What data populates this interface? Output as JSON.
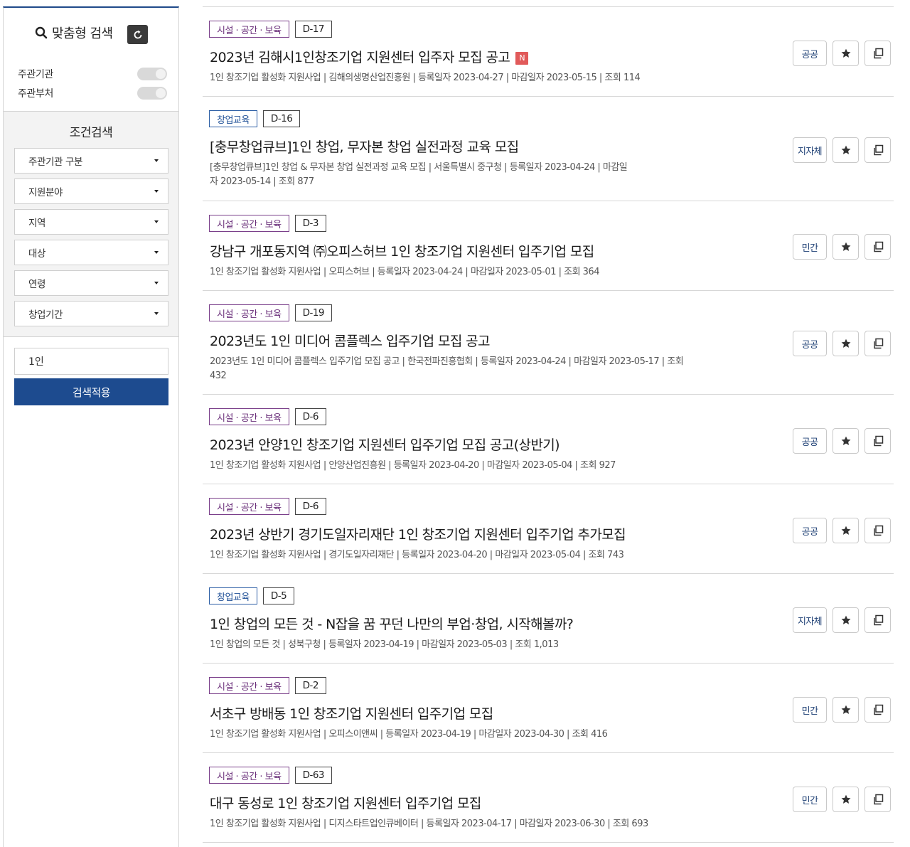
{
  "sidebar": {
    "title": "맞춤형 검색",
    "toggles": [
      {
        "label": "주관기관"
      },
      {
        "label": "주관부처"
      }
    ],
    "condition_title": "조건검색",
    "selects": [
      "주관기관 구분",
      "지원분야",
      "지역",
      "대상",
      "연령",
      "창업기간"
    ],
    "search_value": "1인",
    "apply_label": "검색적용"
  },
  "items": [
    {
      "category": "시설 · 공간 · 보육",
      "category_type": "fac",
      "dday": "D-17",
      "title": "2023년 김해시1인창조기업 지원센터 입주자 모집 공고",
      "new_badge": "N",
      "meta": "1인 창조기업 활성화 지원사업 | 김해의생명산업진흥원 | 등록일자 2023-04-27 | 마감일자 2023-05-15 | 조회 114",
      "org_type": "공공"
    },
    {
      "category": "창업교육",
      "category_type": "edu",
      "dday": "D-16",
      "title": "[충무창업큐브]1인 창업, 무자본 창업 실전과정 교육 모집",
      "new_badge": "",
      "meta": "[충무창업큐브]1인 창업 & 무자본 창업 실전과정 교육 모집 | 서울특별시 중구청 | 등록일자 2023-04-24 | 마감일자 2023-05-14 | 조회 877",
      "org_type": "지자체"
    },
    {
      "category": "시설 · 공간 · 보육",
      "category_type": "fac",
      "dday": "D-3",
      "title": "강남구 개포동지역 ㈜오피스허브 1인 창조기업 지원센터 입주기업 모집",
      "new_badge": "",
      "meta": "1인 창조기업 활성화 지원사업 | 오피스허브 | 등록일자 2023-04-24 | 마감일자 2023-05-01 | 조회 364",
      "org_type": "민간"
    },
    {
      "category": "시설 · 공간 · 보육",
      "category_type": "fac",
      "dday": "D-19",
      "title": "2023년도 1인 미디어 콤플렉스 입주기업 모집 공고",
      "new_badge": "",
      "meta": "2023년도 1인 미디어 콤플렉스 입주기업 모집 공고 | 한국전파진흥협회 | 등록일자 2023-04-24 | 마감일자 2023-05-17 | 조회 432",
      "org_type": "공공"
    },
    {
      "category": "시설 · 공간 · 보육",
      "category_type": "fac",
      "dday": "D-6",
      "title": "2023년 안양1인 창조기업 지원센터 입주기업 모집 공고(상반기)",
      "new_badge": "",
      "meta": "1인 창조기업 활성화 지원사업 | 안양산업진흥원 | 등록일자 2023-04-20 | 마감일자 2023-05-04 | 조회 927",
      "org_type": "공공"
    },
    {
      "category": "시설 · 공간 · 보육",
      "category_type": "fac",
      "dday": "D-6",
      "title": "2023년 상반기 경기도일자리재단 1인 창조기업 지원센터 입주기업 추가모집",
      "new_badge": "",
      "meta": "1인 창조기업 활성화 지원사업 | 경기도일자리재단 | 등록일자 2023-04-20 | 마감일자 2023-05-04 | 조회 743",
      "org_type": "공공"
    },
    {
      "category": "창업교육",
      "category_type": "edu",
      "dday": "D-5",
      "title": "1인 창업의 모든 것 - N잡을 꿈 꾸던 나만의 부업·창업, 시작해볼까?",
      "new_badge": "",
      "meta": "1인 창업의 모든 것 | 성북구청 | 등록일자 2023-04-19 | 마감일자 2023-05-03 | 조회 1,013",
      "org_type": "지자체"
    },
    {
      "category": "시설 · 공간 · 보육",
      "category_type": "fac",
      "dday": "D-2",
      "title": "서초구 방배동 1인 창조기업 지원센터 입주기업 모집",
      "new_badge": "",
      "meta": "1인 창조기업 활성화 지원사업 | 오피스이앤씨 | 등록일자 2023-04-19 | 마감일자 2023-04-30 | 조회 416",
      "org_type": "민간"
    },
    {
      "category": "시설 · 공간 · 보육",
      "category_type": "fac",
      "dday": "D-63",
      "title": "대구 동성로 1인 창조기업 지원센터 입주기업 모집",
      "new_badge": "",
      "meta": "1인 창조기업 활성화 지원사업 | 디지스타트업인큐베이터 | 등록일자 2023-04-17 | 마감일자 2023-06-30 | 조회 693",
      "org_type": "민간"
    }
  ],
  "colors": {
    "accent": "#1d4b8f",
    "facility_tag": "#6a2f7a",
    "education_tag": "#1e4f96",
    "new_badge": "#e15a5a"
  }
}
